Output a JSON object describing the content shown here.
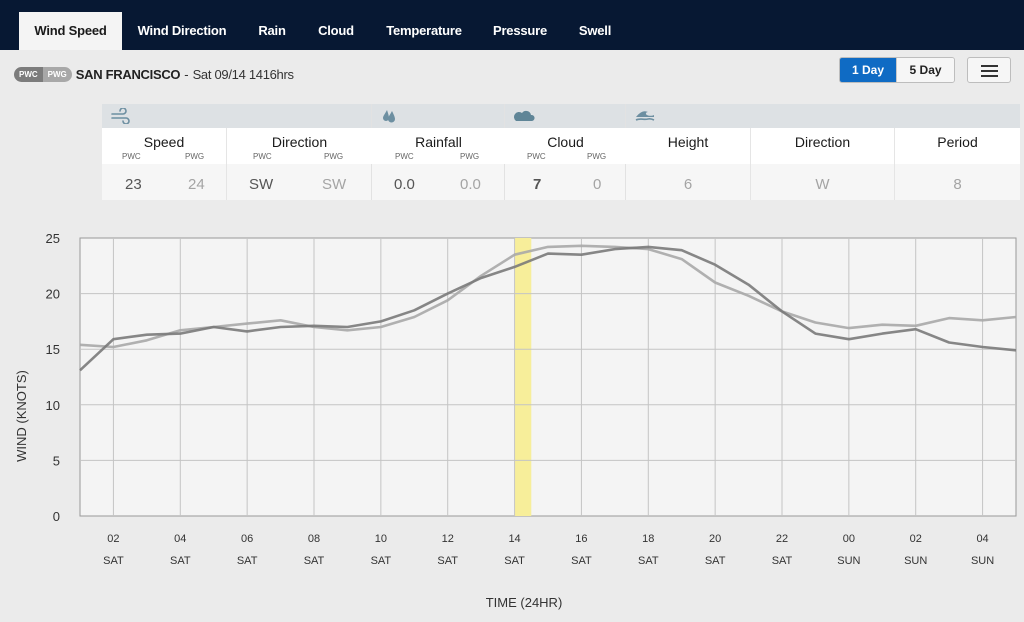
{
  "nav": {
    "tabs": [
      {
        "label": "Wind Speed",
        "active": true
      },
      {
        "label": "Wind Direction",
        "active": false
      },
      {
        "label": "Rain",
        "active": false
      },
      {
        "label": "Cloud",
        "active": false
      },
      {
        "label": "Temperature",
        "active": false
      },
      {
        "label": "Pressure",
        "active": false
      },
      {
        "label": "Swell",
        "active": false
      }
    ]
  },
  "header": {
    "badge_pwc": "PWC",
    "badge_pwg": "PWG",
    "location": "SAN FRANCISCO",
    "separator": "-",
    "datetime": "Sat 09/14 1416hrs",
    "range_options": [
      "1 Day",
      "5 Day"
    ],
    "range_selected": "1 Day",
    "menu_icon": "hamburger-menu-icon",
    "accent_color": "#0f6bc4"
  },
  "summary": {
    "groups": [
      {
        "icon": "wind-icon",
        "cells": [
          {
            "title": "Speed",
            "pwc_label": "PWC",
            "pwg_label": "PWG",
            "pwc": "23",
            "pwg": "24"
          },
          {
            "title": "Direction",
            "pwc_label": "PWC",
            "pwg_label": "PWG",
            "pwc": "SW",
            "pwg": "SW"
          }
        ]
      },
      {
        "icon": "rain-drops-icon",
        "cells": [
          {
            "title": "Rainfall",
            "pwc_label": "PWC",
            "pwg_label": "PWG",
            "pwc": "0.0",
            "pwg": "0.0"
          }
        ]
      },
      {
        "icon": "cloud-icon",
        "cells": [
          {
            "title": "Cloud",
            "pwc_label": "PWC",
            "pwg_label": "PWG",
            "pwc": "7",
            "pwg": "0"
          }
        ]
      },
      {
        "icon": "swell-wave-icon",
        "cells": [
          {
            "title": "Height",
            "value": "6"
          },
          {
            "title": "Direction",
            "value": "W"
          },
          {
            "title": "Period",
            "value": "8"
          }
        ]
      }
    ]
  },
  "chart_data": {
    "type": "line",
    "title": "",
    "xlabel": "TIME (24HR)",
    "ylabel": "WIND (KNOTS)",
    "ylim": [
      0,
      25
    ],
    "yticks": [
      0,
      5,
      10,
      15,
      20,
      25
    ],
    "xlim_hours": [
      1,
      29
    ],
    "grid": true,
    "xticks": [
      {
        "hour": 2,
        "label": "02",
        "day": "SAT"
      },
      {
        "hour": 4,
        "label": "04",
        "day": "SAT"
      },
      {
        "hour": 6,
        "label": "06",
        "day": "SAT"
      },
      {
        "hour": 8,
        "label": "08",
        "day": "SAT"
      },
      {
        "hour": 10,
        "label": "10",
        "day": "SAT"
      },
      {
        "hour": 12,
        "label": "12",
        "day": "SAT"
      },
      {
        "hour": 14,
        "label": "14",
        "day": "SAT"
      },
      {
        "hour": 16,
        "label": "16",
        "day": "SAT"
      },
      {
        "hour": 18,
        "label": "18",
        "day": "SAT"
      },
      {
        "hour": 20,
        "label": "20",
        "day": "SAT"
      },
      {
        "hour": 22,
        "label": "22",
        "day": "SAT"
      },
      {
        "hour": 24,
        "label": "00",
        "day": "SUN"
      },
      {
        "hour": 26,
        "label": "02",
        "day": "SUN"
      },
      {
        "hour": 28,
        "label": "04",
        "day": "SUN"
      }
    ],
    "current_time_band": {
      "start_hour": 14.0,
      "end_hour": 14.5,
      "color": "#f7ee9a"
    },
    "x_hours": [
      1,
      2,
      3,
      4,
      5,
      6,
      7,
      8,
      9,
      10,
      11,
      12,
      13,
      14,
      15,
      16,
      17,
      18,
      19,
      20,
      21,
      22,
      23,
      24,
      25,
      26,
      27,
      28,
      29
    ],
    "series": [
      {
        "name": "PWC",
        "color": "#7a7a7a",
        "values": [
          13.1,
          15.9,
          16.3,
          16.4,
          17.0,
          16.6,
          17.0,
          17.1,
          17.0,
          17.5,
          18.5,
          20.0,
          21.4,
          22.4,
          23.6,
          23.5,
          24.0,
          24.2,
          23.9,
          22.6,
          20.8,
          18.4,
          16.4,
          15.9,
          16.4,
          16.8,
          15.6,
          15.2,
          14.9
        ]
      },
      {
        "name": "PWG",
        "color": "#a9a9a9",
        "values": [
          15.4,
          15.2,
          15.8,
          16.7,
          17.0,
          17.3,
          17.6,
          17.0,
          16.7,
          17.0,
          17.9,
          19.4,
          21.6,
          23.5,
          24.2,
          24.3,
          24.2,
          24.0,
          23.1,
          21.0,
          19.8,
          18.4,
          17.4,
          16.9,
          17.2,
          17.1,
          17.8,
          17.6,
          17.9
        ]
      }
    ]
  }
}
